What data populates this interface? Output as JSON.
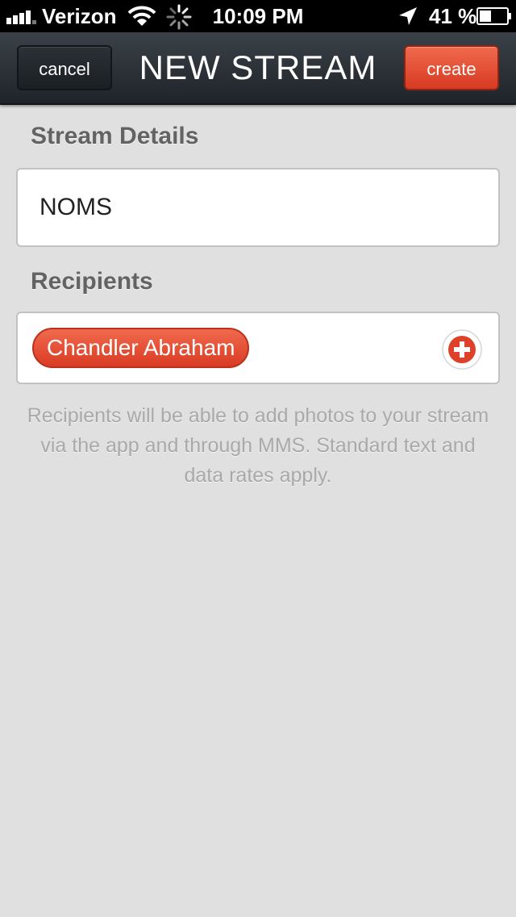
{
  "status_bar": {
    "carrier": "Verizon",
    "time": "10:09 PM",
    "battery_percent": "41 %",
    "signal_level": 4,
    "icons": [
      "signal-bars-icon",
      "wifi-icon",
      "activity-spinner-icon",
      "location-arrow-icon",
      "battery-icon"
    ]
  },
  "nav": {
    "title": "NEW STREAM",
    "cancel_label": "cancel",
    "create_label": "create"
  },
  "stream_details": {
    "heading": "Stream Details",
    "name_value": "NOMS"
  },
  "recipients": {
    "heading": "Recipients",
    "items": [
      {
        "name": "Chandler Abraham"
      }
    ],
    "add_icon": "plus-circle-icon",
    "note": "Recipients will be able to add photos to your stream via the app and through MMS. Standard text and data rates apply."
  },
  "colors": {
    "accent_red": "#e04a2f",
    "nav_dark": "#2a3035",
    "background": "#e0e0e0",
    "heading_gray": "#636363",
    "note_gray": "#a9a9a9"
  }
}
